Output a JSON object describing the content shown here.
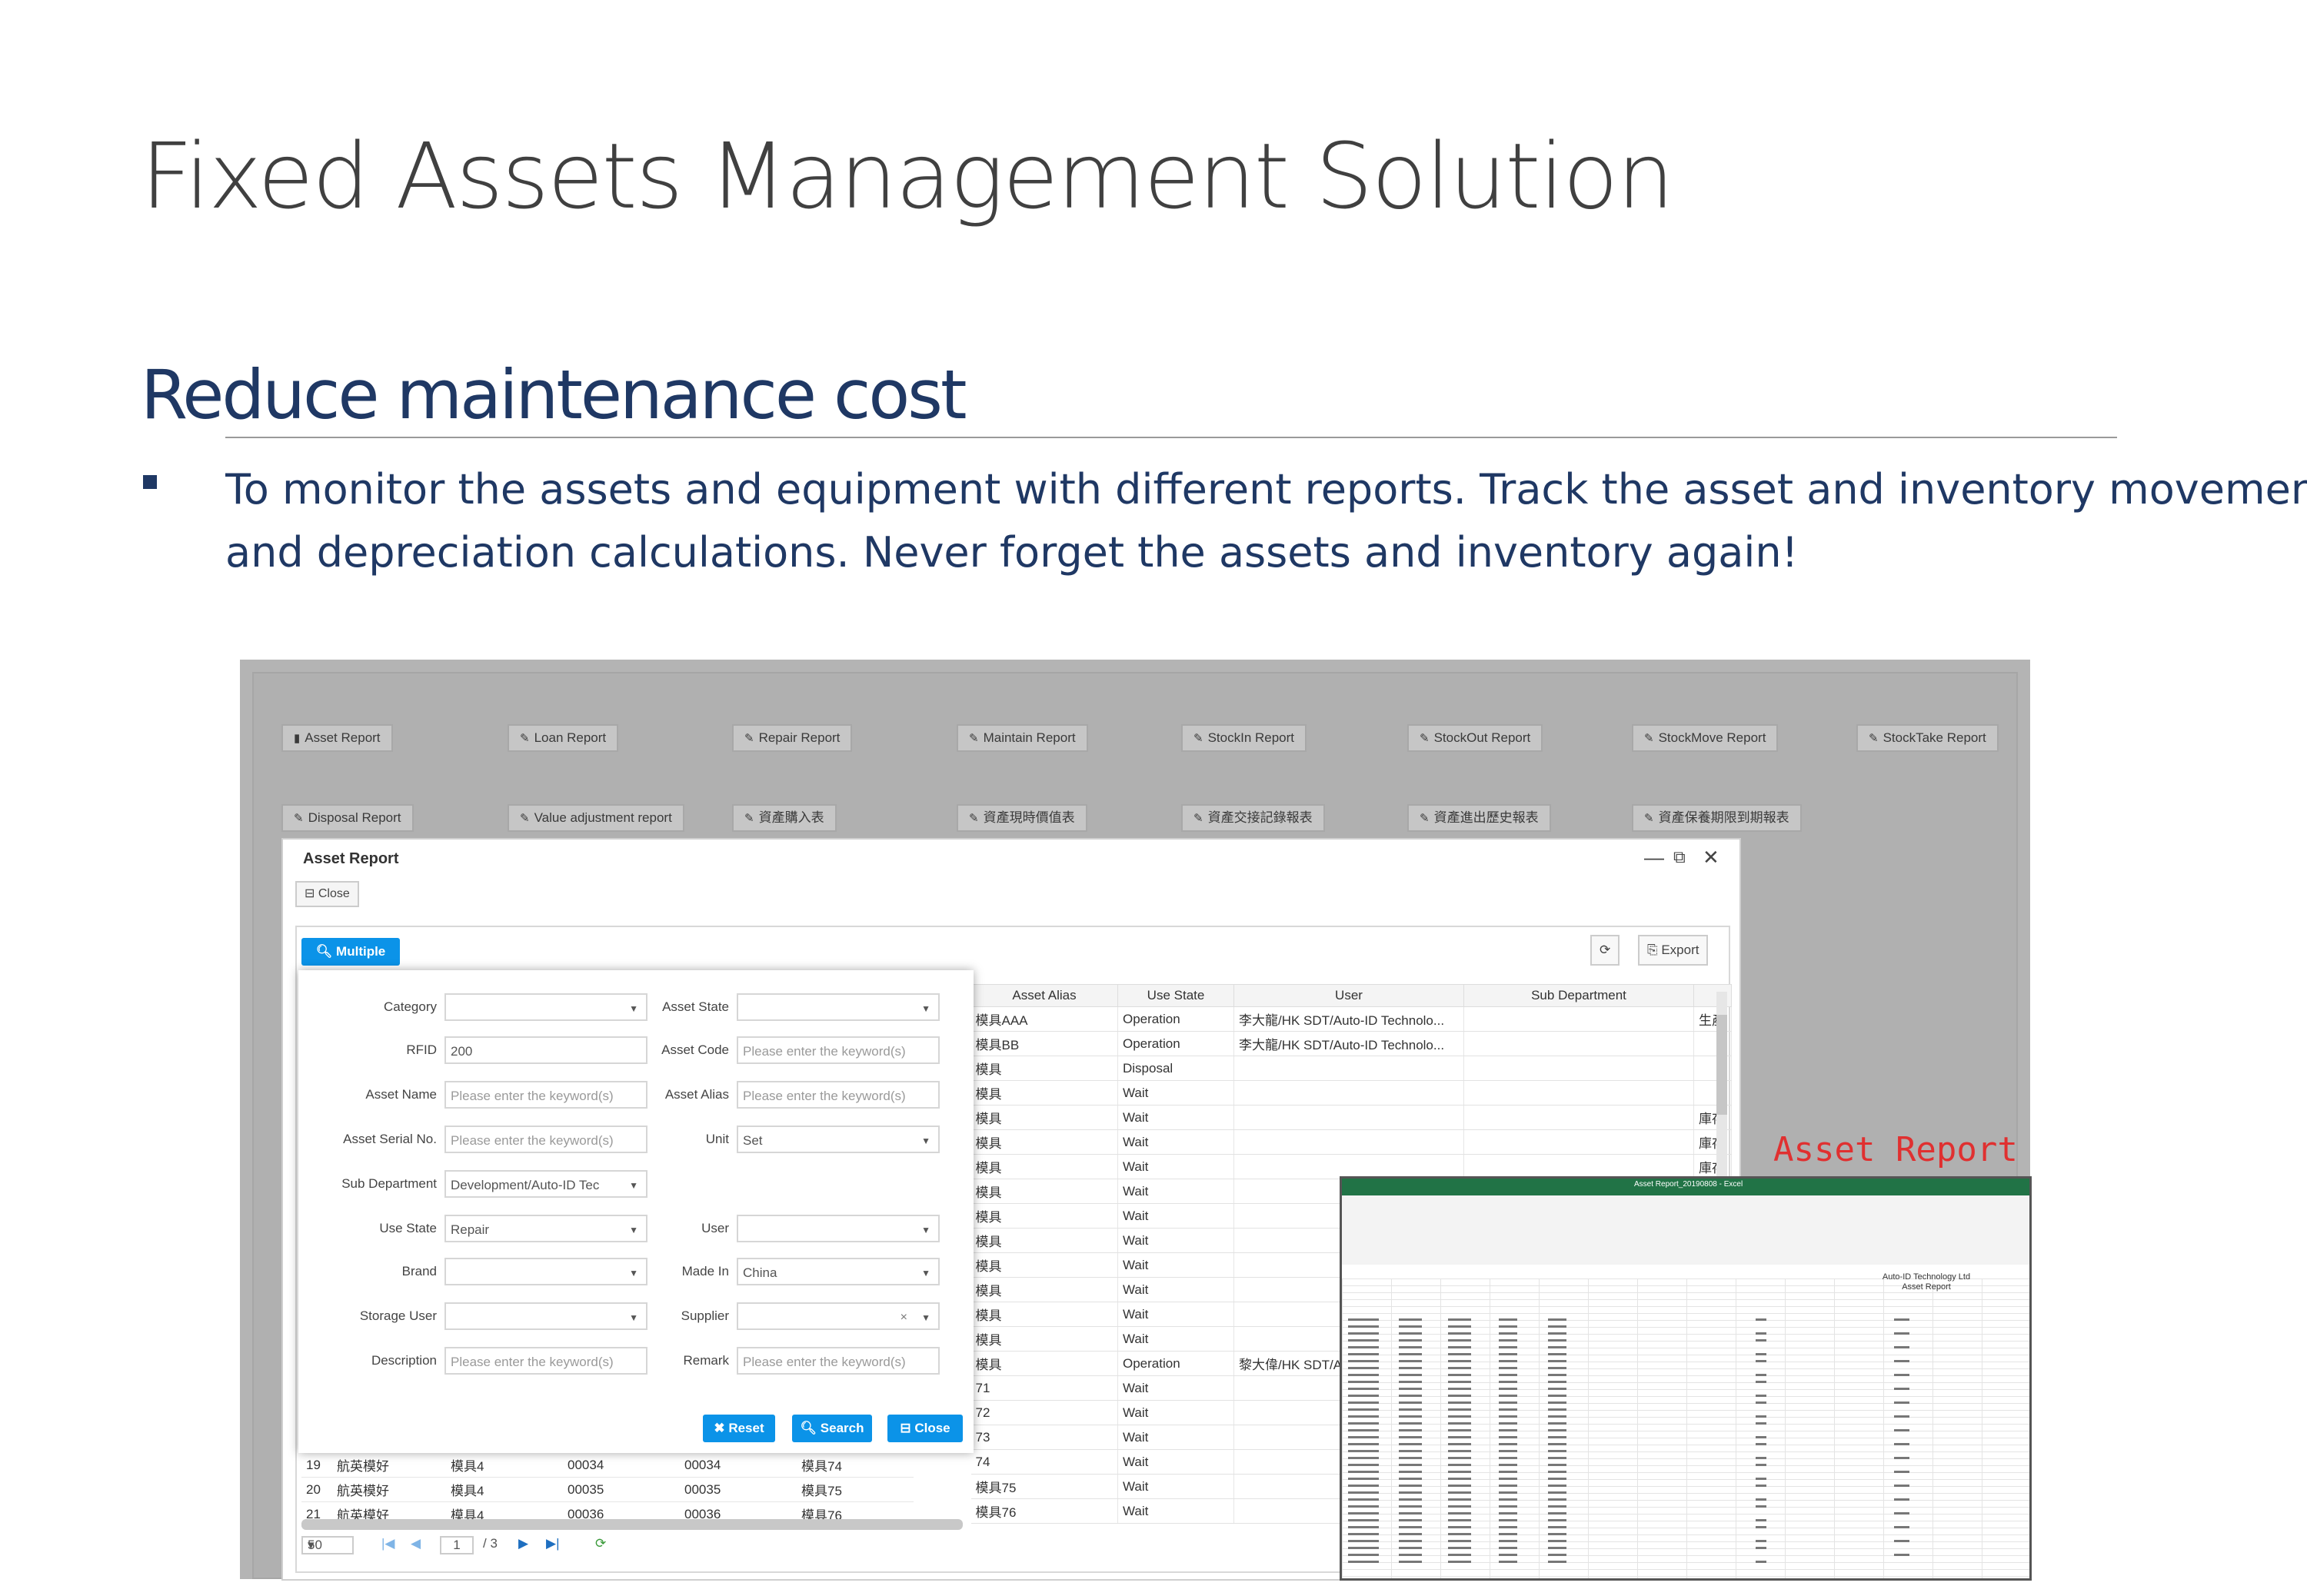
{
  "slide": {
    "title": "Fixed Assets Management Solution",
    "subtitle": "Reduce maintenance cost",
    "bullet_line1": "To monitor the assets and equipment with different reports. Track the asset and inventory movement",
    "bullet_line2": "and depreciation calculations. Never forget the assets and inventory again!"
  },
  "reports_row1": [
    "Asset Report",
    "Loan Report",
    "Repair Report",
    "Maintain Report",
    "StockIn Report",
    "StockOut Report",
    "StockMove Report",
    "StockTake Report"
  ],
  "reports_row2": [
    "Disposal Report",
    "Value adjustment report",
    "資產購入表",
    "資產現時價值表",
    "資產交接記錄報表",
    "資產進出歷史報表",
    "資產保養期限到期報表"
  ],
  "window": {
    "title": "Asset Report",
    "close_label": "Close",
    "multiple_label": "Multiple",
    "refresh_icon": "refresh-icon",
    "export_label": "Export"
  },
  "grid": {
    "headers": [
      "Asset Alias",
      "Use State",
      "User",
      "Sub Department",
      ""
    ],
    "rows": [
      [
        "模具AAA",
        "Operation",
        "李大龍/HK SDT/Auto-ID Technolo...",
        "",
        "生產"
      ],
      [
        "模具BB",
        "Operation",
        "李大龍/HK SDT/Auto-ID Technolo...",
        "",
        ""
      ],
      [
        "模具",
        "Disposal",
        "",
        "",
        ""
      ],
      [
        "模具",
        "Wait",
        "",
        "",
        ""
      ],
      [
        "模具",
        "Wait",
        "",
        "",
        "庫存"
      ],
      [
        "模具",
        "Wait",
        "",
        "",
        "庫存"
      ],
      [
        "模具",
        "Wait",
        "",
        "",
        "庫存"
      ],
      [
        "模具",
        "Wait",
        "",
        "",
        ""
      ],
      [
        "模具",
        "Wait",
        "",
        "",
        ""
      ],
      [
        "模具",
        "Wait",
        "",
        "",
        ""
      ],
      [
        "模具",
        "Wait",
        "",
        "",
        ""
      ],
      [
        "模具",
        "Wait",
        "",
        "",
        ""
      ],
      [
        "模具",
        "Wait",
        "",
        "",
        ""
      ],
      [
        "模具",
        "Wait",
        "",
        "",
        ""
      ],
      [
        "模具",
        "Operation",
        "黎大偉/HK SDT/Au",
        "",
        ""
      ],
      [
        "71",
        "Wait",
        "",
        "",
        ""
      ],
      [
        "72",
        "Wait",
        "",
        "",
        ""
      ],
      [
        "73",
        "Wait",
        "",
        "",
        ""
      ],
      [
        "74",
        "Wait",
        "",
        "",
        ""
      ],
      [
        "模具75",
        "Wait",
        "",
        "",
        ""
      ],
      [
        "模具76",
        "Wait",
        "",
        "",
        ""
      ]
    ]
  },
  "lower_rows": [
    [
      "19",
      "航英模好",
      "模具4",
      "00034",
      "00034",
      "模具74"
    ],
    [
      "20",
      "航英模好",
      "模具4",
      "00035",
      "00035",
      "模具75"
    ],
    [
      "21",
      "航英模好",
      "模具4",
      "00036",
      "00036",
      "模具76"
    ]
  ],
  "pager": {
    "page_size": "50",
    "page": "1",
    "total": "/ 3"
  },
  "form": {
    "fields": [
      {
        "label": "Category",
        "value": "",
        "placeholder": false,
        "dropdown": true
      },
      {
        "label": "Asset State",
        "value": "",
        "placeholder": false,
        "dropdown": true
      },
      {
        "label": "RFID",
        "value": "200",
        "placeholder": false,
        "dropdown": false
      },
      {
        "label": "Asset Code",
        "value": "Please enter the keyword(s)",
        "placeholder": true,
        "dropdown": false
      },
      {
        "label": "Asset Name",
        "value": "Please enter the keyword(s)",
        "placeholder": true,
        "dropdown": false
      },
      {
        "label": "Asset Alias",
        "value": "Please enter the keyword(s)",
        "placeholder": true,
        "dropdown": false
      },
      {
        "label": "Asset Serial No.",
        "value": "Please enter the keyword(s)",
        "placeholder": true,
        "dropdown": false
      },
      {
        "label": "Unit",
        "value": "Set",
        "placeholder": false,
        "dropdown": true
      },
      {
        "label": "Sub Department",
        "value": "Development/Auto-ID Tec",
        "placeholder": false,
        "dropdown": true
      },
      {
        "label": "Use State",
        "value": "Repair",
        "placeholder": false,
        "dropdown": true
      },
      {
        "label": "User",
        "value": "",
        "placeholder": false,
        "dropdown": true
      },
      {
        "label": "Brand",
        "value": "",
        "placeholder": false,
        "dropdown": true
      },
      {
        "label": "Made In",
        "value": "China",
        "placeholder": false,
        "dropdown": true
      },
      {
        "label": "Storage User",
        "value": "",
        "placeholder": false,
        "dropdown": true
      },
      {
        "label": "Supplier",
        "value": "",
        "placeholder": false,
        "dropdown": true,
        "clear": "×"
      },
      {
        "label": "Description",
        "value": "Please enter the keyword(s)",
        "placeholder": true,
        "dropdown": false
      },
      {
        "label": "Remark",
        "value": "Please enter the keyword(s)",
        "placeholder": true,
        "dropdown": false
      }
    ],
    "reset_label": "Reset",
    "search_label": "Search",
    "close_label": "Close"
  },
  "annotation": "Asset Report",
  "excel": {
    "title_bar": "Asset Report_20190808 - Excel",
    "company": "Auto-ID Technology Ltd",
    "report_title": "Asset Report"
  },
  "colors": {
    "accent": "#0b93e8",
    "title": "#404040",
    "navy": "#1f3864",
    "excel_green": "#217346",
    "annotation": "#e03030"
  }
}
